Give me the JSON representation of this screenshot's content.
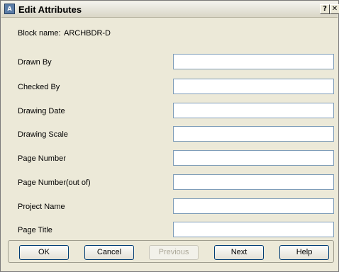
{
  "window": {
    "title": "Edit Attributes",
    "icon": "app-icon",
    "help_glyph": "?",
    "close_glyph": "✕"
  },
  "block": {
    "label": "Block name:",
    "value": "ARCHBDR-D"
  },
  "attributes": [
    {
      "label": "Drawn By",
      "value": ""
    },
    {
      "label": "Checked By",
      "value": ""
    },
    {
      "label": "Drawing Date",
      "value": ""
    },
    {
      "label": "Drawing Scale",
      "value": ""
    },
    {
      "label": "Page Number",
      "value": ""
    },
    {
      "label": "Page Number(out of)",
      "value": ""
    },
    {
      "label": "Project Name",
      "value": ""
    },
    {
      "label": "Page Title",
      "value": ""
    }
  ],
  "buttons": {
    "ok": "OK",
    "cancel": "Cancel",
    "previous": "Previous",
    "next": "Next",
    "help": "Help"
  }
}
